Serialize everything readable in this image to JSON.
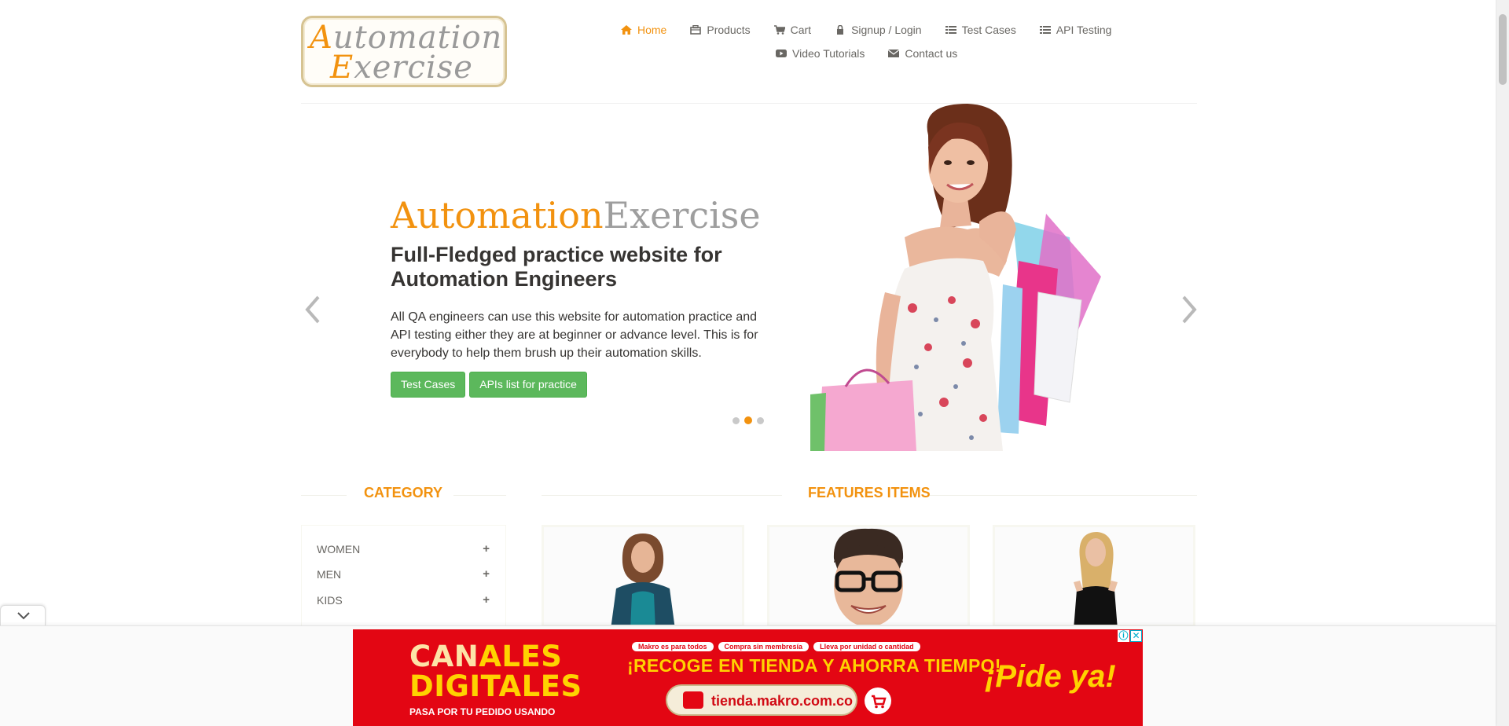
{
  "header": {
    "logo_line1_cap": "A",
    "logo_line1_rest": "utomation",
    "logo_line2_cap": "E",
    "logo_line2_rest": "xercise",
    "nav": [
      {
        "label": "Home",
        "icon": "home-icon"
      },
      {
        "label": "Products",
        "icon": "products-icon"
      },
      {
        "label": "Cart",
        "icon": "cart-icon"
      },
      {
        "label": "Signup / Login",
        "icon": "lock-icon"
      },
      {
        "label": "Test Cases",
        "icon": "list-icon"
      },
      {
        "label": "API Testing",
        "icon": "list-icon"
      },
      {
        "label": "Video Tutorials",
        "icon": "youtube-icon"
      },
      {
        "label": "Contact us",
        "icon": "envelope-icon"
      }
    ]
  },
  "slider": {
    "brand_part1": "Automation",
    "brand_part2": "Exercise",
    "title": "Full-Fledged practice website for Automation Engineers",
    "description": "All QA engineers can use this website for automation practice and API testing either they are at beginner or advance level. This is for everybody to help them brush up their automation skills.",
    "buttons": [
      "Test Cases",
      "APIs list for practice"
    ],
    "active_slide": 2,
    "slide_count": 3
  },
  "sidebar": {
    "title": "Category",
    "categories": [
      "WOMEN",
      "MEN",
      "KIDS"
    ]
  },
  "features": {
    "title": "Features Items"
  },
  "ad": {
    "headline_1a": "CAN",
    "headline_1b": "ALES",
    "headline_2a": "DIGIT",
    "headline_2b": "ALES",
    "sub": "PASA POR TU PEDIDO USANDO",
    "pills": [
      "Makro es para todos",
      "Compra sin membresía",
      "Lleva por unidad o cantidad"
    ],
    "cta": "¡RECOGE EN TIENDA Y AHORRA TIEMPO!",
    "url": "tienda.makro.com.co",
    "pide": "¡Pide ya!",
    "info": "ⓘ",
    "close": "✕"
  },
  "colors": {
    "accent": "#f2920f",
    "button_green": "#5cb85c",
    "text": "#696763",
    "ad_red": "#e30613"
  }
}
